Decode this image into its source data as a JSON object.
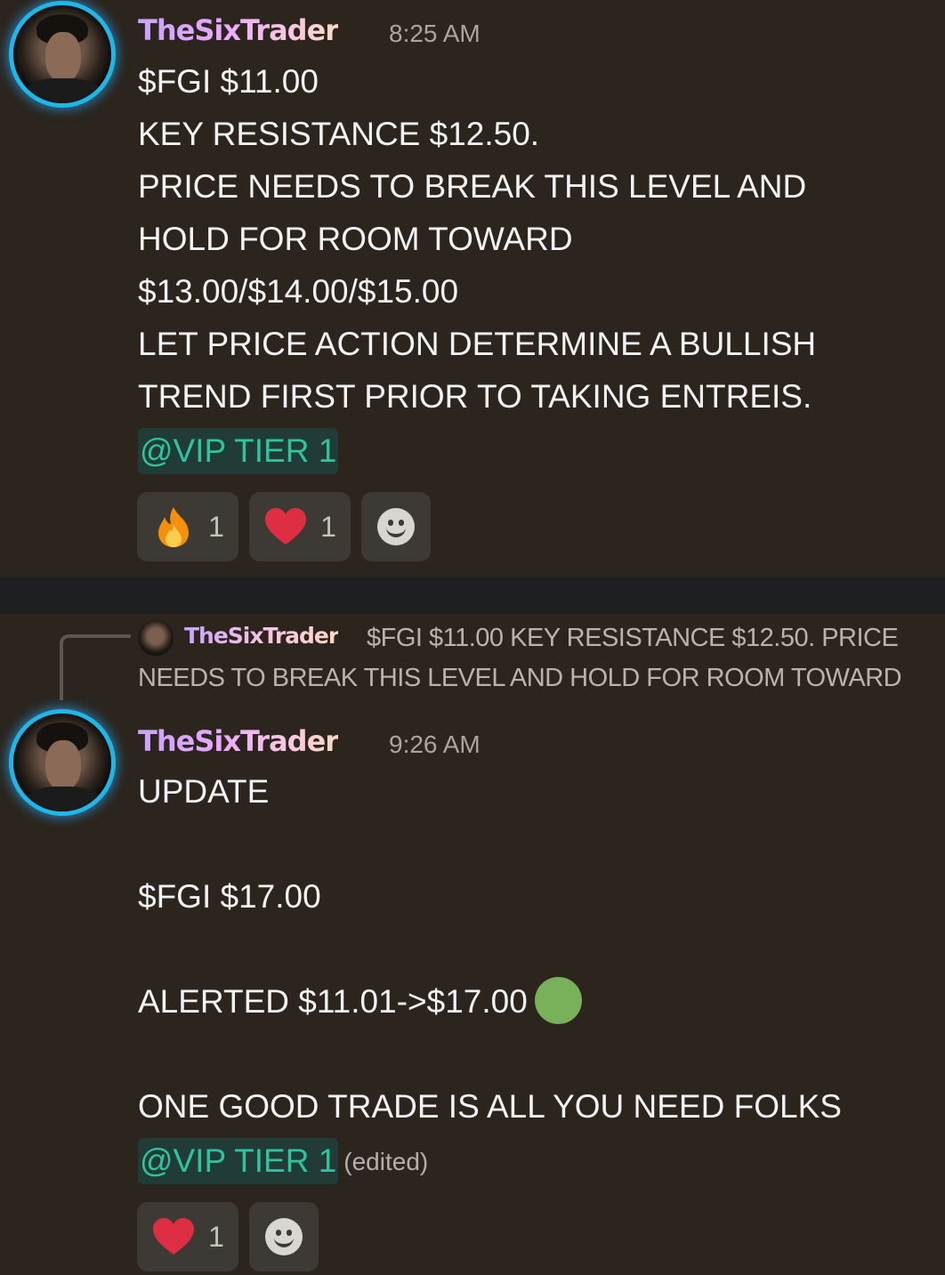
{
  "messages": [
    {
      "username": "TheSixTrader",
      "time": "8:25 AM",
      "lines": [
        "$FGI $11.00",
        "KEY RESISTANCE $12.50.",
        "PRICE NEEDS TO BREAK THIS LEVEL AND",
        "HOLD FOR ROOM TOWARD",
        "$13.00/$14.00/$15.00",
        "LET PRICE ACTION DETERMINE A BULLISH",
        "TREND FIRST PRIOR TO TAKING ENTREIS."
      ],
      "mention": "@VIP TIER 1",
      "reactions": [
        {
          "emoji": "fire-icon",
          "count": "1"
        },
        {
          "emoji": "heart-icon",
          "count": "1"
        }
      ]
    },
    {
      "reply": {
        "username": "TheSixTrader",
        "text": "$FGI $11.00 KEY RESISTANCE $12.50.  PRICE NEEDS TO BREAK THIS LEVEL AND HOLD FOR ROOM TOWARD"
      },
      "username": "TheSixTrader",
      "time": "9:26 AM",
      "lines": [
        "UPDATE",
        "",
        "$FGI $17.00",
        "",
        "ALERTED $11.01->$17.00",
        "",
        "ONE GOOD TRADE IS ALL YOU NEED FOLKS"
      ],
      "status_emoji": "green-circle",
      "mention": "@VIP TIER 1",
      "edited": "(edited)",
      "reactions": [
        {
          "emoji": "heart-icon",
          "count": "1"
        }
      ]
    }
  ],
  "colors": {
    "background": "#2b251d",
    "divider": "#1e1f22",
    "mention_text": "#2fc49d",
    "mention_bg": "#213b36",
    "reaction_bg": "#3d3a35"
  }
}
